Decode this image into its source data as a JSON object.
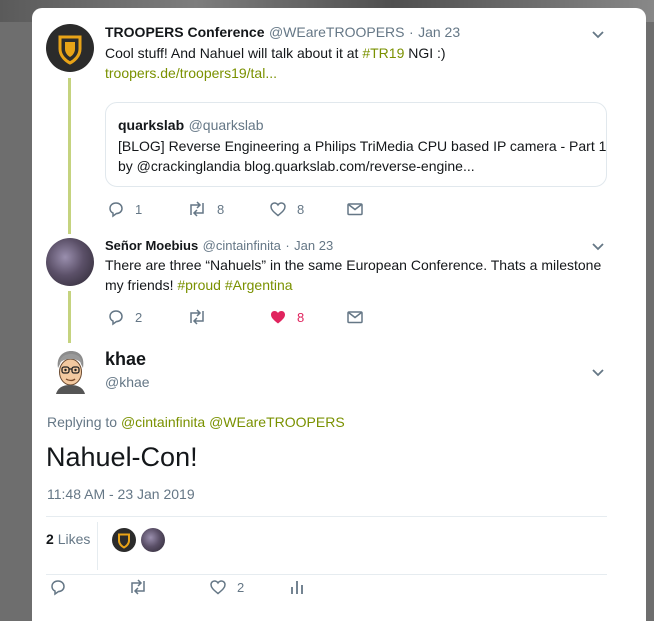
{
  "tweet1": {
    "name": "TROOPERS Conference",
    "handle": "@WEareTROOPERS",
    "separator": "·",
    "date": "Jan 23",
    "text_pre": "Cool stuff! And Nahuel will talk about it at ",
    "hashtag": "#TR19",
    "text_post": " NGI :)",
    "link": "troopers.de/troopers19/tal...",
    "quote": {
      "name": "quarkslab",
      "handle": "@quarkslab",
      "line1": "[BLOG] Reverse Engineering a Philips TriMedia CPU based IP camera - Part 1",
      "line2": "by @crackinglandia blog.quarkslab.com/reverse-engine..."
    },
    "replies": "1",
    "retweets": "8",
    "likes": "8"
  },
  "tweet2": {
    "name": "Señor Moebius",
    "handle": "@cintainfinita",
    "separator": "·",
    "date": "Jan 23",
    "line1": "There are three “Nahuels” in the same European Conference. Thats a milestone",
    "line2_pre": "my friends! ",
    "hashtag1": "#proud",
    "hashtag2": "#Argentina",
    "replies": "2",
    "likes": "8"
  },
  "main": {
    "name": "khae",
    "handle": "@khae",
    "replying_label": "Replying to",
    "replying_to_1": "@cintainfinita",
    "replying_to_2": "@WEareTROOPERS",
    "text": "Nahuel-Con!",
    "timestamp": "11:48 AM - 23 Jan 2019",
    "likes_count": "2",
    "likes_label": "Likes",
    "like_action_count": "2"
  },
  "colors": {
    "accent": "#7a9100",
    "thread_line": "#c5d37f",
    "liked": "#e0245e",
    "muted": "#657786"
  }
}
